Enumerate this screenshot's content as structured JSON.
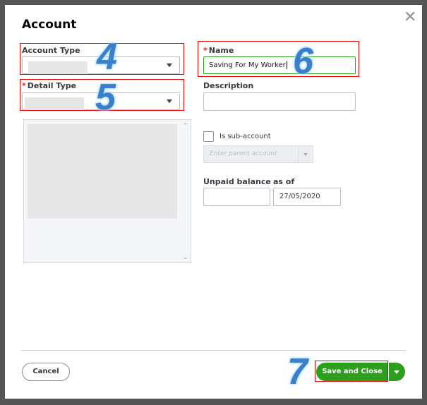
{
  "dialog": {
    "title": "Account",
    "close_icon": "close-icon"
  },
  "account_type": {
    "label": "Account Type"
  },
  "detail_type": {
    "label": "Detail Type",
    "required": "*"
  },
  "name": {
    "label": "Name",
    "required": "*",
    "value": "Saving For My Worker"
  },
  "description": {
    "label": "Description",
    "value": ""
  },
  "sub_account": {
    "label": "Is sub-account",
    "checked": false,
    "parent_placeholder": "Enter parent account"
  },
  "unpaid_balance": {
    "label": "Unpaid balance",
    "value": ""
  },
  "as_of": {
    "label": "as of",
    "value": "27/05/2020"
  },
  "footer": {
    "cancel_label": "Cancel",
    "save_label": "Save and Close"
  },
  "annotations": {
    "a4": "4",
    "a5": "5",
    "a6": "6",
    "a7": "7"
  },
  "colors": {
    "primary": "#2ca01c",
    "highlight": "#e00000",
    "annotation": "#3a7fc8"
  }
}
